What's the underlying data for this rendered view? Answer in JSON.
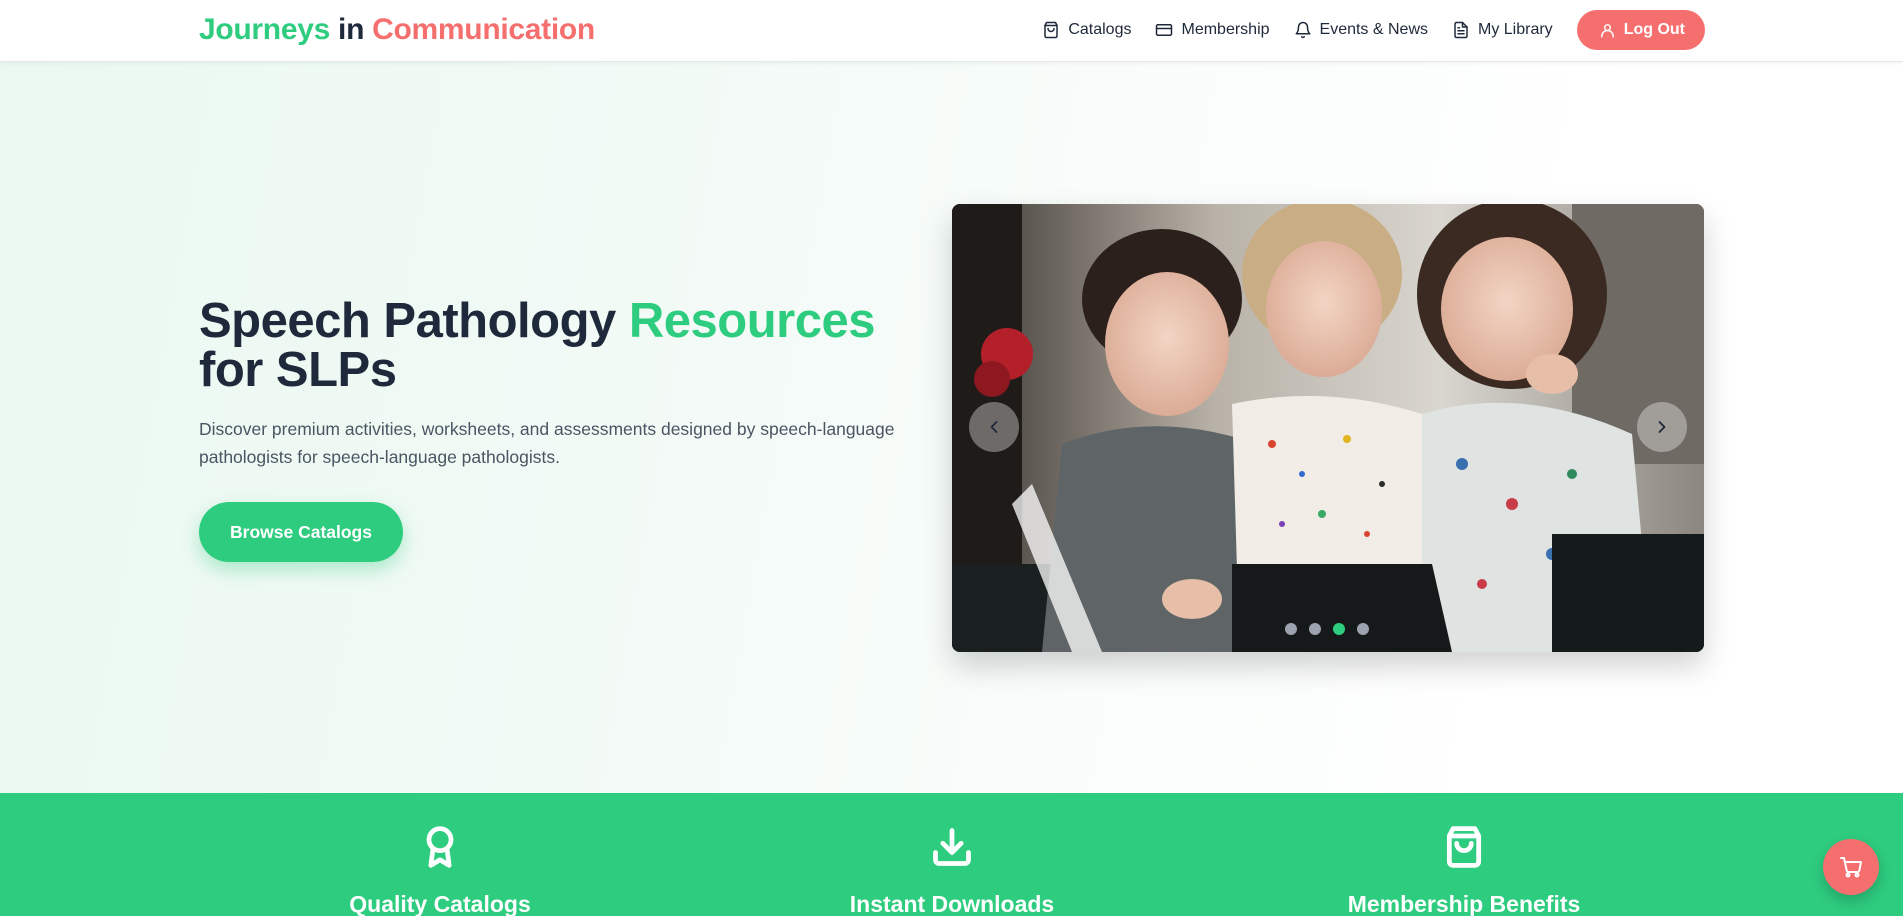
{
  "brand": {
    "word1": "Journeys",
    "word2": "in",
    "word3": "Communication",
    "colors": {
      "green": "#2ecc7f",
      "coral": "#f56f6f",
      "dark": "#1e293b"
    }
  },
  "nav": {
    "items": [
      {
        "label": "Catalogs",
        "icon": "shopping-bag-icon"
      },
      {
        "label": "Membership",
        "icon": "credit-card-icon"
      },
      {
        "label": "Events & News",
        "icon": "bell-icon"
      },
      {
        "label": "My Library",
        "icon": "document-icon"
      }
    ],
    "logout": {
      "label": "Log Out",
      "icon": "user-icon"
    }
  },
  "hero": {
    "title_part1": "Speech Pathology ",
    "title_accent": "Resources",
    "title_part2": "for SLPs",
    "description": "Discover premium activities, worksheets, and assessments designed by speech-language pathologists for speech-language pathologists.",
    "cta_label": "Browse Catalogs"
  },
  "carousel": {
    "slide_count": 4,
    "active_index": 2,
    "image": "three-laughing-children-photo",
    "prev_icon": "chevron-left-icon",
    "next_icon": "chevron-right-icon"
  },
  "features": [
    {
      "title": "Quality Catalogs",
      "icon": "award-ribbon-icon"
    },
    {
      "title": "Instant Downloads",
      "icon": "download-icon"
    },
    {
      "title": "Membership Benefits",
      "icon": "shopping-bag-icon"
    }
  ],
  "cart": {
    "icon": "shopping-cart-icon"
  }
}
